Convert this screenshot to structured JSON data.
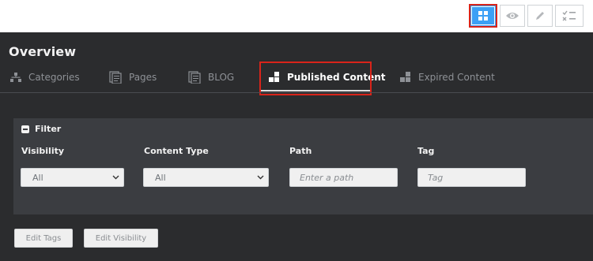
{
  "toolbar": {
    "buttons": [
      {
        "icon": "grid-icon",
        "active": true
      },
      {
        "icon": "eye-icon",
        "active": false
      },
      {
        "icon": "pencil-icon",
        "active": false
      },
      {
        "icon": "checklist-icon",
        "active": false
      }
    ],
    "accent": "#3ba0f5",
    "highlight": "#d9241a"
  },
  "header": {
    "title": "Overview"
  },
  "tabs": [
    {
      "label": "Categories",
      "icon": "hierarchy-icon"
    },
    {
      "label": "Pages",
      "icon": "pages-icon"
    },
    {
      "label": "BLOG",
      "icon": "pages-icon"
    },
    {
      "label": "Published Content",
      "icon": "blocks-icon",
      "active": true
    },
    {
      "label": "Expired Content",
      "icon": "blocks-icon"
    }
  ],
  "filter": {
    "title": "Filter",
    "fields": [
      {
        "label": "Visibility",
        "value": "All",
        "type": "select"
      },
      {
        "label": "Content Type",
        "value": "All",
        "type": "select"
      },
      {
        "label": "Path",
        "placeholder": "Enter a path",
        "type": "input"
      },
      {
        "label": "Tag",
        "placeholder": "Tag",
        "type": "input"
      }
    ]
  },
  "actions": {
    "edit_tags": "Edit Tags",
    "edit_visibility": "Edit Visibility"
  }
}
